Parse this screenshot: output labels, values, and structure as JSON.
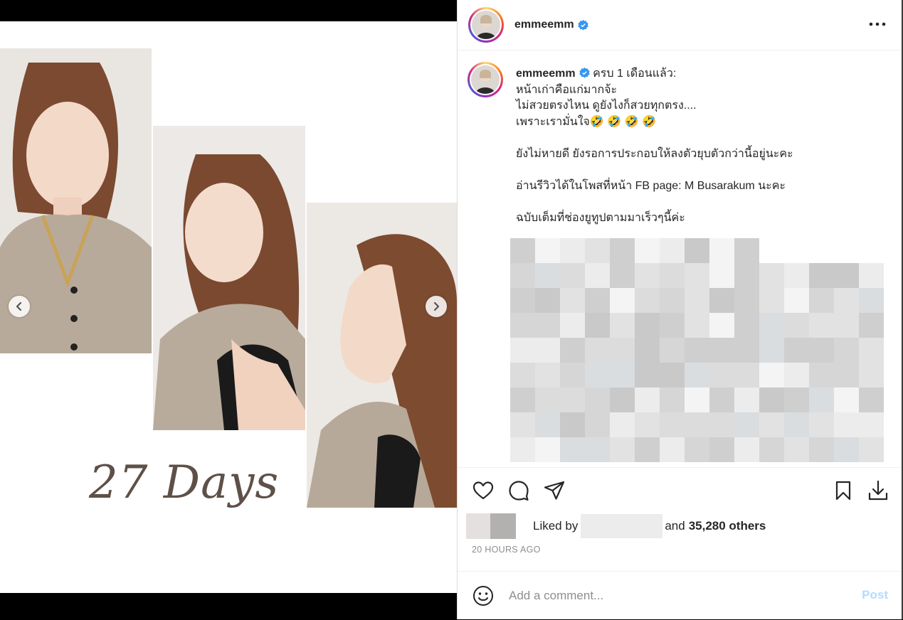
{
  "post": {
    "username": "emmeemm",
    "verified": true,
    "more_icon": "more-horizontal-icon",
    "media": {
      "overlay_text": "27 Days",
      "prev_icon": "chevron-left-icon",
      "next_icon": "chevron-right-icon"
    },
    "caption": {
      "username": "emmeemm",
      "first_line": "ครบ 1 เดือนแล้ว:",
      "lines": [
        "หน้าเก่าคือแก่มากจ้ะ",
        "ไม่สวยตรงไหน ดูยังไงก็สวยทุกตรง....",
        "เพราะเรามั่นใจ🤣 🤣 🤣 🤣",
        "",
        "ยังไม่หายดี ยังรอการประกอบให้ลงตัวยุบตัวกว่านี้อยู่นะคะ",
        "",
        "อ่านรีวิวได้ในโพสที่หน้า FB page: M Busarakum นะคะ",
        "",
        "ฉบับเต็มที่ช่องยูทูปตามมาเร็วๆนี้ค่ะ"
      ]
    },
    "actions": {
      "like_icon": "heart-icon",
      "comment_icon": "comment-icon",
      "share_icon": "send-icon",
      "save_icon": "bookmark-icon",
      "download_icon": "download-icon"
    },
    "likes": {
      "prefix": "Liked by",
      "connector": "and",
      "count_text": "35,280 others"
    },
    "timestamp": "20 HOURS AGO",
    "comment": {
      "emoji_icon": "smiley-icon",
      "placeholder": "Add a comment...",
      "post_label": "Post"
    }
  }
}
